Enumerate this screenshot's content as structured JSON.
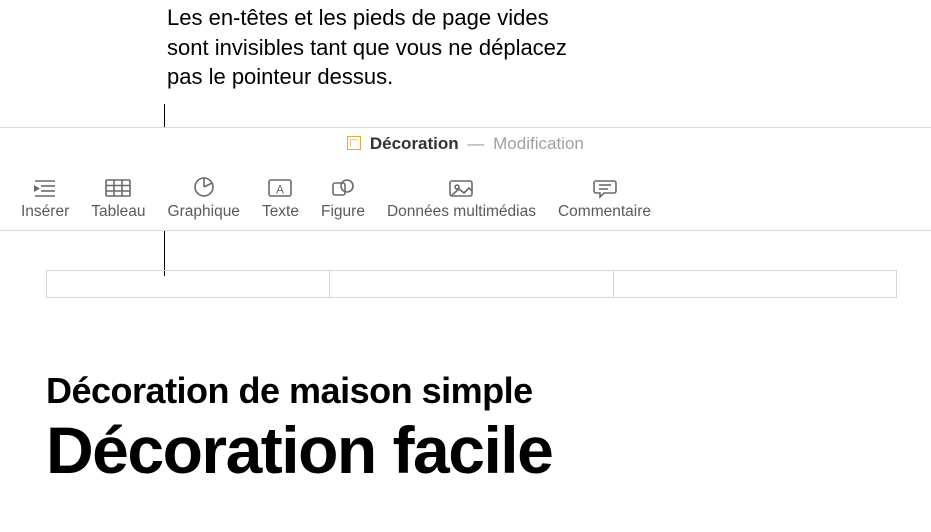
{
  "callout": "Les en-têtes et les pieds de page vides sont invisibles tant que vous ne déplacez pas le pointeur dessus.",
  "titlebar": {
    "doc_name": "Décoration",
    "status": "Modification"
  },
  "toolbar": {
    "insert": "Insérer",
    "table": "Tableau",
    "chart": "Graphique",
    "text": "Texte",
    "shape": "Figure",
    "media": "Données multimédias",
    "comment": "Commentaire"
  },
  "document": {
    "subtitle": "Décoration de maison simple",
    "title": "Décoration facile"
  }
}
